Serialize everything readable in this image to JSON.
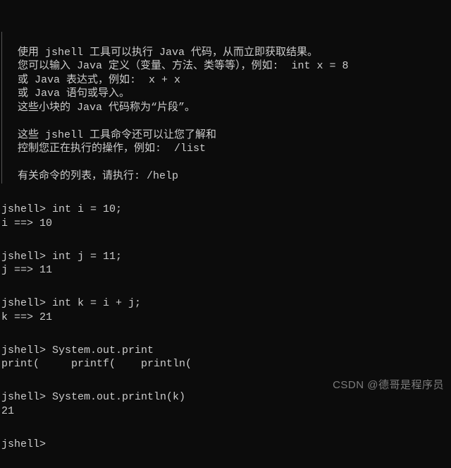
{
  "intro": {
    "line1": "使用 jshell 工具可以执行 Java 代码，从而立即获取结果。",
    "line2": "您可以输入 Java 定义（变量、方法、类等等），例如:  int x = 8",
    "line3": "或 Java 表达式，例如:  x + x",
    "line4": "或 Java 语句或导入。",
    "line5": "这些小块的 Java 代码称为“片段”。",
    "line6": "",
    "line7": "这些 jshell 工具命令还可以让您了解和",
    "line8": "控制您正在执行的操作，例如:  /list",
    "line9": "",
    "line10": "有关命令的列表，请执行: /help"
  },
  "session": {
    "prompt": "jshell>",
    "cmd1": " int i = 10;",
    "out1": "i ==> 10",
    "cmd2": " int j = 11;",
    "out2": "j ==> 11",
    "cmd3": " int k = i + j;",
    "out3": "k ==> 21",
    "cmd4": " System.out.print",
    "completions": "print(     printf(    println(",
    "cmd5": " System.out.println(k)",
    "out5": "21",
    "cmd6": ""
  },
  "watermark": "CSDN @德哥是程序员"
}
